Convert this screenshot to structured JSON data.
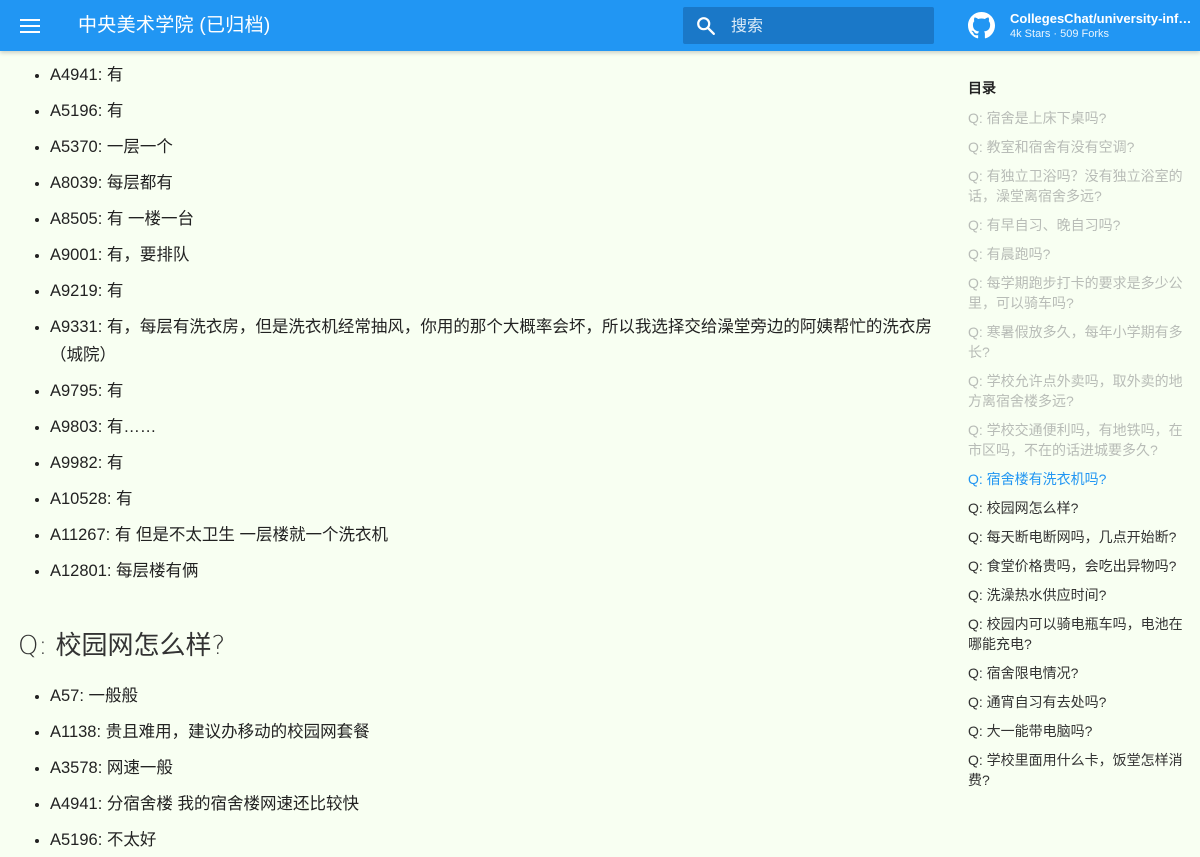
{
  "header": {
    "title": "中央美术学院 (已归档)",
    "search_placeholder": "搜索",
    "repo_name": "CollegesChat/university-information",
    "repo_stats": "4k Stars · 509 Forks"
  },
  "colors": {
    "header": "#2196f3",
    "background": "#f8fff2",
    "toc_active": "#2196f3",
    "toc_read": "#b8bcb7"
  },
  "main": {
    "answers_top": [
      "A4941: 有",
      "A5196: 有",
      "A5370: 一层一个",
      "A8039: 每层都有",
      "A8505: 有 一楼一台",
      "A9001: 有，要排队",
      "A9219: 有",
      "A9331: 有，每层有洗衣房，但是洗衣机经常抽风，你用的那个大概率会坏，所以我选择交给澡堂旁边的阿姨帮忙的洗衣房（城院）",
      "A9795: 有",
      "A9803: 有……",
      "A9982: 有",
      "A10528: 有",
      "A11267: 有 但是不太卫生 一层楼就一个洗衣机",
      "A12801: 每层楼有俩"
    ],
    "section_title": "Q: 校园网怎么样?",
    "answers_bottom": [
      "A57: 一般般",
      "A1138: 贵且难用，建议办移动的校园网套餐",
      "A3578: 网速一般",
      "A4941: 分宿舍楼 我的宿舍楼网速还比较快",
      "A5196: 不太好"
    ]
  },
  "toc": {
    "title": "目录",
    "items": [
      {
        "label": "Q: 宿舍是上床下桌吗?",
        "state": "read"
      },
      {
        "label": "Q: 教室和宿舍有没有空调?",
        "state": "read"
      },
      {
        "label": "Q: 有独立卫浴吗？没有独立浴室的话，澡堂离宿舍多远?",
        "state": "read"
      },
      {
        "label": "Q: 有早自习、晚自习吗?",
        "state": "read"
      },
      {
        "label": "Q: 有晨跑吗?",
        "state": "read"
      },
      {
        "label": "Q: 每学期跑步打卡的要求是多少公里，可以骑车吗?",
        "state": "read"
      },
      {
        "label": "Q: 寒暑假放多久，每年小学期有多长?",
        "state": "read"
      },
      {
        "label": "Q: 学校允许点外卖吗，取外卖的地方离宿舍楼多远?",
        "state": "read"
      },
      {
        "label": "Q: 学校交通便利吗，有地铁吗，在市区吗，不在的话进城要多久?",
        "state": "read"
      },
      {
        "label": "Q: 宿舍楼有洗衣机吗?",
        "state": "active"
      },
      {
        "label": "Q: 校园网怎么样?",
        "state": "normal"
      },
      {
        "label": "Q: 每天断电断网吗，几点开始断?",
        "state": "normal"
      },
      {
        "label": "Q: 食堂价格贵吗，会吃出异物吗?",
        "state": "normal"
      },
      {
        "label": "Q: 洗澡热水供应时间?",
        "state": "normal"
      },
      {
        "label": "Q: 校园内可以骑电瓶车吗，电池在哪能充电?",
        "state": "normal"
      },
      {
        "label": "Q: 宿舍限电情况?",
        "state": "normal"
      },
      {
        "label": "Q: 通宵自习有去处吗?",
        "state": "normal"
      },
      {
        "label": "Q: 大一能带电脑吗?",
        "state": "normal"
      },
      {
        "label": "Q: 学校里面用什么卡，饭堂怎样消费?",
        "state": "normal"
      }
    ]
  }
}
